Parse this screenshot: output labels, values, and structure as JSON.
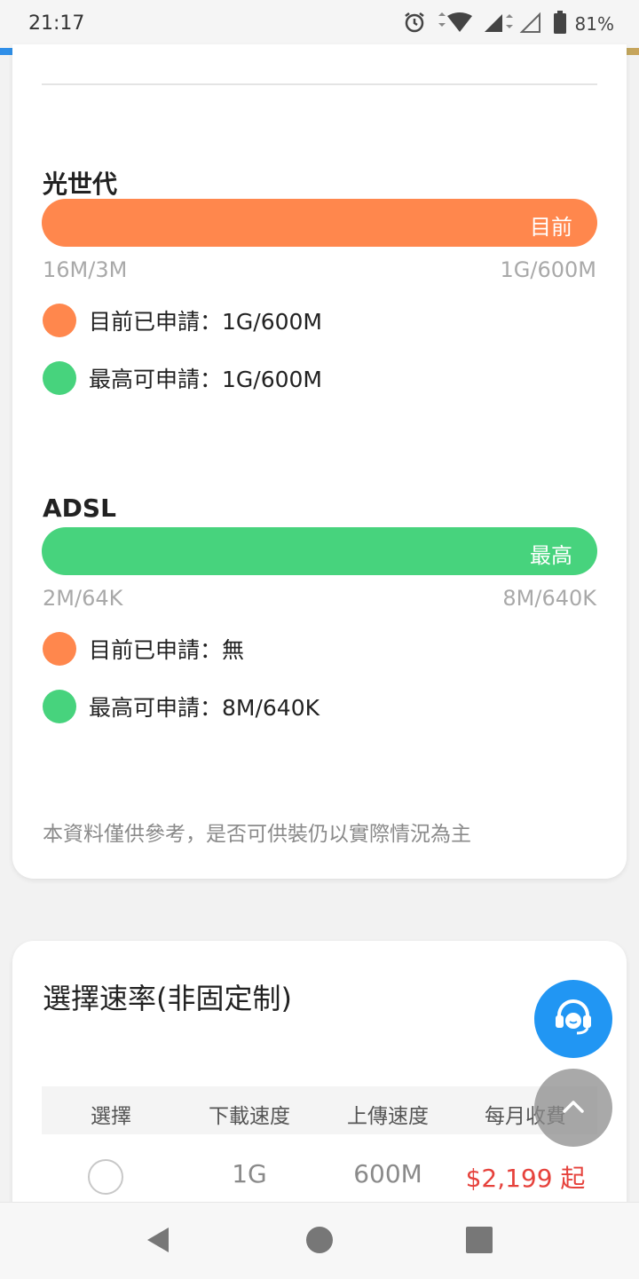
{
  "status_bar": {
    "time": "21:17",
    "battery": "81%"
  },
  "fiber": {
    "title": "光世代",
    "bar_label": "目前",
    "range_min": "16M/3M",
    "range_max": "1G/600M",
    "applied": "目前已申請：1G/600M",
    "max_available": "最高可申請：1G/600M"
  },
  "adsl": {
    "title": "ADSL",
    "bar_label": "最高",
    "range_min": "2M/64K",
    "range_max": "8M/640K",
    "applied": "目前已申請：無",
    "max_available": "最高可申請：8M/640K"
  },
  "note": "本資料僅供參考，是否可供裝仍以實際情況為主",
  "rate_section": {
    "title": "選擇速率(非固定制)",
    "headers": [
      "選擇",
      "下載速度",
      "上傳速度",
      "每月收費"
    ],
    "rows": [
      {
        "download": "1G",
        "upload": "600M",
        "price": "$2,199 起"
      }
    ]
  },
  "colors": {
    "orange": "#ff874d",
    "green": "#47d37d",
    "fab_blue": "#2196f3",
    "price_red": "#e6423c"
  },
  "icons": [
    "alarm-icon",
    "wifi-icon",
    "signal-icon",
    "battery-icon",
    "headset-icon",
    "chevron-up-icon",
    "back-icon",
    "home-icon",
    "recents-icon"
  ]
}
